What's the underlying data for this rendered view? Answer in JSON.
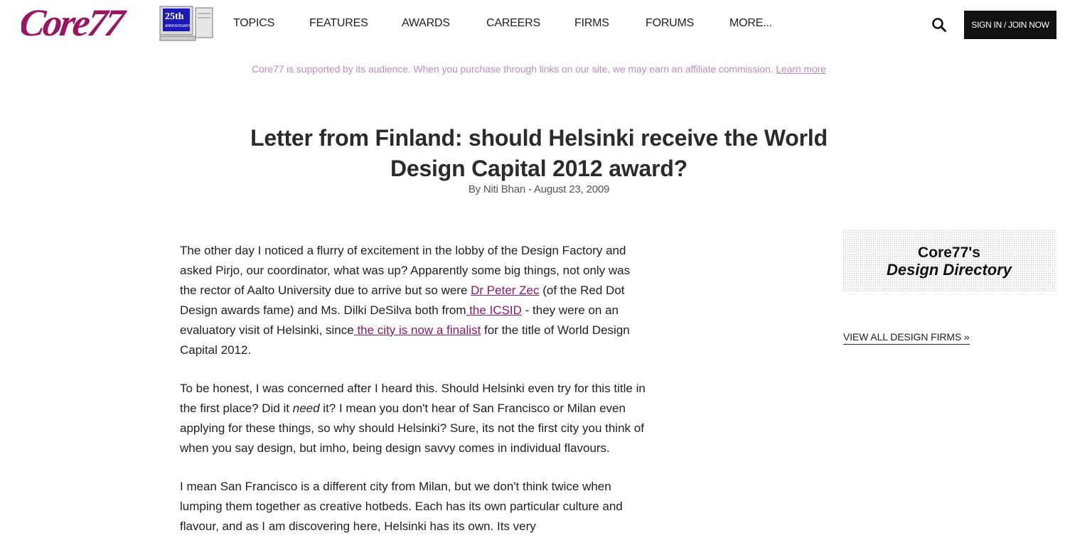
{
  "header": {
    "logo_text": "Core77",
    "badge_text": "25th",
    "nav": [
      "TOPICS",
      "FEATURES",
      "AWARDS",
      "CAREERS",
      "FIRMS",
      "FORUMS",
      "MORE..."
    ],
    "signin_label": "SIGN IN / JOIN NOW"
  },
  "affiliate": {
    "text": "Core77 is supported by its audience. When you purchase through links on our site, we may earn an affiliate commission. ",
    "link": "Learn more"
  },
  "article": {
    "title": "Letter from Finland: should Helsinki receive the World Design Capital 2012 award?",
    "byline": "By Niti Bhan - August 23, 2009",
    "p1": {
      "t1": "The other day I noticed a flurry of excitement in the lobby of the Design Factory and asked Pirjo, our coordinator, what was up? Apparently some big things, not only was the rector of Aalto University due to arrive but so were ",
      "link1": "Dr Peter Zec",
      "t2": " (of the Red Dot Design awards fame) and Ms. Dilki DeSilva both from",
      "link2": " the ICSID",
      "t3": " - they were on an evaluatory visit of Helsinki, since",
      "link3": " the city is now a finalist",
      "t4": " for the title of World Design Capital 2012."
    },
    "p2": {
      "t1": "To be honest, I was concerned after I heard this. Should Helsinki even try for this title in the first place? Did it ",
      "em": "need",
      "t2": " it? I mean you don't hear of San Francisco or Milan even applying for these things, so why should Helsinki? Sure, its not the first city you think of when you say design, but imho, being design savvy comes in individual flavours."
    },
    "p3": "I mean San Francisco is a different city from Milan, but we don't think twice when lumping them together as creative hotbeds. Each has its own particular culture and flavour, and as I am discovering here, Helsinki has its own. Its very"
  },
  "sidebar": {
    "dir_line1": "Core77's",
    "dir_line2": "Design Directory",
    "view_all": "VIEW ALL DESIGN FIRMS »"
  },
  "colors": {
    "brand": "#9b1461",
    "link": "#8a1a6b",
    "affiliate": "#b88fc0"
  },
  "icons": {
    "search": "search-icon"
  }
}
